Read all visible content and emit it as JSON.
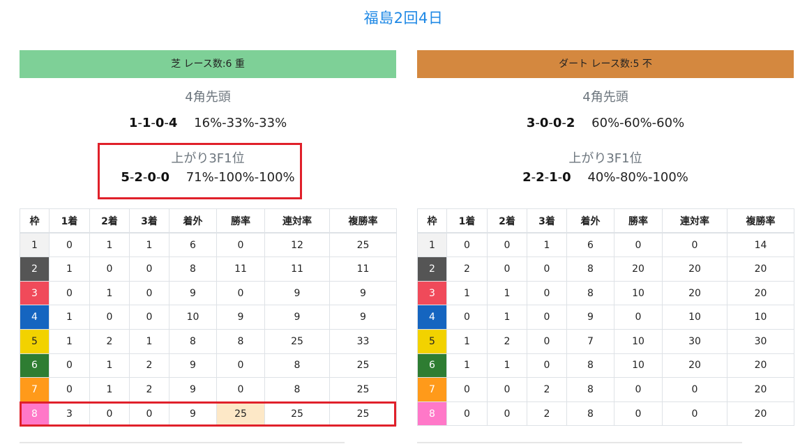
{
  "title": "福島2回4日",
  "colors": {
    "turf_header": "#7ed097",
    "dirt_header": "#d4883f",
    "highlight_border": "#e0202a",
    "highlight_cell": "#fde8c7"
  },
  "waku_colors": [
    {
      "bg": "#f2f2f2",
      "fg": "#222222"
    },
    {
      "bg": "#555555",
      "fg": "#ffffff"
    },
    {
      "bg": "#f04a5a",
      "fg": "#ffffff"
    },
    {
      "bg": "#1565c0",
      "fg": "#ffffff"
    },
    {
      "bg": "#f2d200",
      "fg": "#222222"
    },
    {
      "bg": "#2e7d32",
      "fg": "#ffffff"
    },
    {
      "bg": "#ff9a1a",
      "fg": "#ffffff"
    },
    {
      "bg": "#ff78c8",
      "fg": "#ffffff"
    }
  ],
  "columns": [
    "枠",
    "1着",
    "2着",
    "3着",
    "着外",
    "勝率",
    "連対率",
    "複勝率"
  ],
  "turf": {
    "header": "芝 レース数:6  重",
    "stat1": {
      "label": "4角先頭",
      "r": [
        "1",
        "1",
        "0",
        "4"
      ],
      "pct": "16%-33%-33%"
    },
    "stat2": {
      "label": "上がり3F1位",
      "r": [
        "5",
        "2",
        "0",
        "0"
      ],
      "pct": "71%-100%-100%"
    },
    "rows": [
      [
        "1",
        "0",
        "1",
        "1",
        "6",
        "0",
        "12",
        "25"
      ],
      [
        "2",
        "1",
        "0",
        "0",
        "8",
        "11",
        "11",
        "11"
      ],
      [
        "3",
        "0",
        "1",
        "0",
        "9",
        "0",
        "9",
        "9"
      ],
      [
        "4",
        "1",
        "0",
        "0",
        "10",
        "9",
        "9",
        "9"
      ],
      [
        "5",
        "1",
        "2",
        "1",
        "8",
        "8",
        "25",
        "33"
      ],
      [
        "6",
        "0",
        "1",
        "2",
        "9",
        "0",
        "8",
        "25"
      ],
      [
        "7",
        "0",
        "1",
        "2",
        "9",
        "0",
        "8",
        "25"
      ],
      [
        "8",
        "3",
        "0",
        "0",
        "9",
        "25",
        "25",
        "25"
      ]
    ]
  },
  "dirt": {
    "header": "ダート レース数:5  不",
    "stat1": {
      "label": "4角先頭",
      "r": [
        "3",
        "0",
        "0",
        "2"
      ],
      "pct": "60%-60%-60%"
    },
    "stat2": {
      "label": "上がり3F1位",
      "r": [
        "2",
        "2",
        "1",
        "0"
      ],
      "pct": "40%-80%-100%"
    },
    "rows": [
      [
        "1",
        "0",
        "0",
        "1",
        "6",
        "0",
        "0",
        "14"
      ],
      [
        "2",
        "2",
        "0",
        "0",
        "8",
        "20",
        "20",
        "20"
      ],
      [
        "3",
        "1",
        "1",
        "0",
        "8",
        "10",
        "20",
        "20"
      ],
      [
        "4",
        "0",
        "1",
        "0",
        "9",
        "0",
        "10",
        "10"
      ],
      [
        "5",
        "1",
        "2",
        "0",
        "7",
        "10",
        "30",
        "30"
      ],
      [
        "6",
        "1",
        "1",
        "0",
        "8",
        "10",
        "20",
        "20"
      ],
      [
        "7",
        "0",
        "0",
        "2",
        "8",
        "0",
        "0",
        "20"
      ],
      [
        "8",
        "0",
        "0",
        "2",
        "8",
        "0",
        "0",
        "20"
      ]
    ]
  }
}
